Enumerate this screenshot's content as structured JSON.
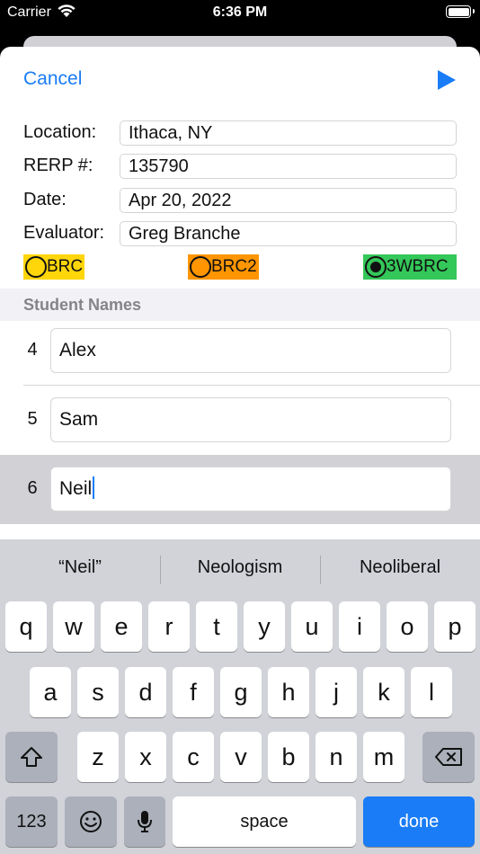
{
  "status_bar": {
    "carrier": "Carrier",
    "time": "6:36 PM"
  },
  "nav": {
    "cancel_label": "Cancel",
    "run_icon": "play-icon"
  },
  "form": {
    "location_label": "Location:",
    "location_value": "Ithaca, NY",
    "rerp_label": "RERP #:",
    "rerp_value": "135790",
    "date_label": "Date:",
    "date_value": "Apr 20, 2022",
    "evaluator_label": "Evaluator:",
    "evaluator_value": "Greg Branche"
  },
  "course_options": [
    {
      "label": "BRC",
      "color": "#ffd60a",
      "selected": false
    },
    {
      "label": "BRC2",
      "color": "#ff9500",
      "selected": false
    },
    {
      "label": "3WBRC",
      "color": "#34c759",
      "selected": true
    }
  ],
  "students": {
    "header": "Student Names",
    "rows": [
      {
        "number": "4",
        "name": "Alex"
      },
      {
        "number": "5",
        "name": "Sam"
      },
      {
        "number": "6",
        "name": "Neil"
      }
    ]
  },
  "keyboard": {
    "suggestions": [
      "“Neil”",
      "Neologism",
      "Neoliberal"
    ],
    "row1": [
      "q",
      "w",
      "e",
      "r",
      "t",
      "y",
      "u",
      "i",
      "o",
      "p"
    ],
    "row2": [
      "a",
      "s",
      "d",
      "f",
      "g",
      "h",
      "j",
      "k",
      "l"
    ],
    "row3": [
      "z",
      "x",
      "c",
      "v",
      "b",
      "n",
      "m"
    ],
    "numbers_label": "123",
    "space_label": "space",
    "done_label": "done"
  },
  "colors": {
    "accent": "#1a7cf6"
  }
}
